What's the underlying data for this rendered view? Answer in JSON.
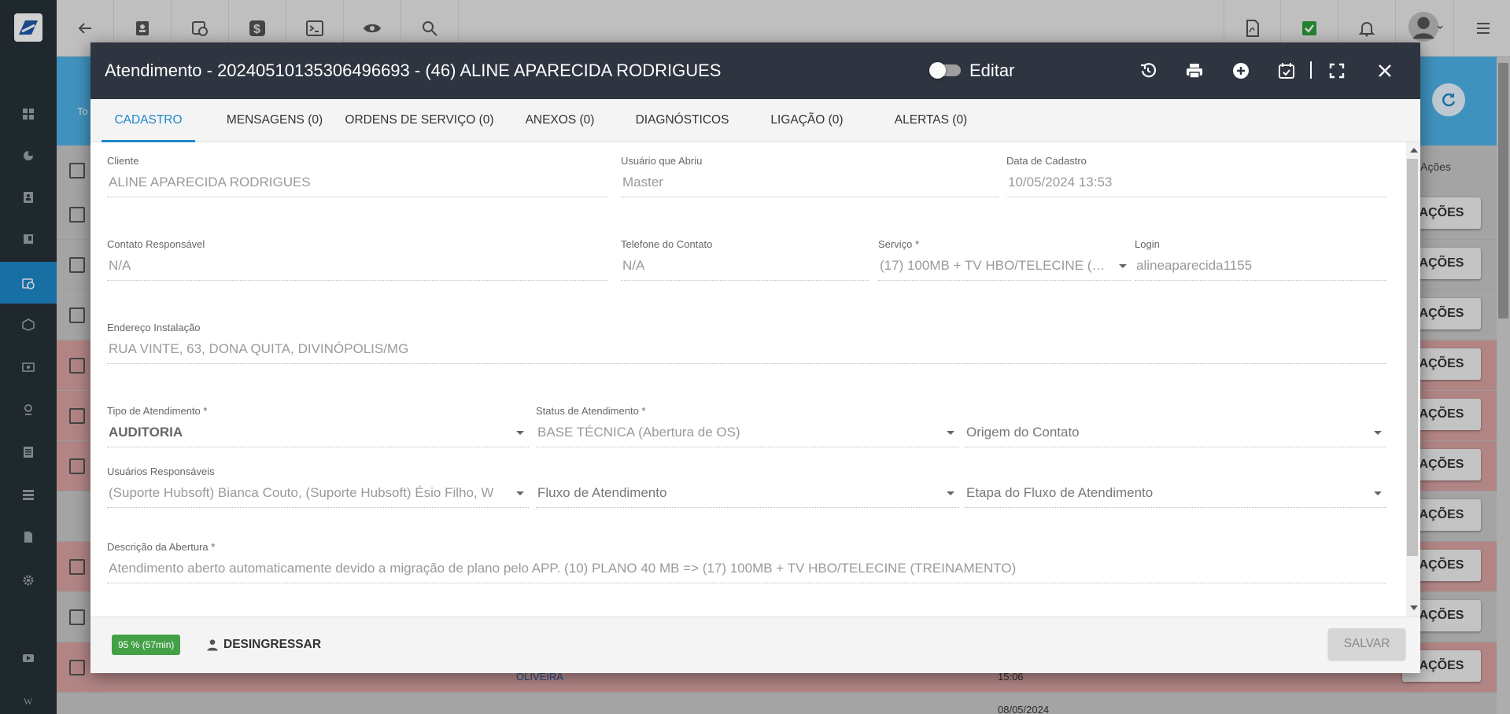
{
  "topbar": {
    "icons": [
      "back-arrow-icon",
      "contact-card-icon",
      "calendar-clock-icon",
      "dollar-icon",
      "terminal-icon",
      "eye-icon",
      "search-icon",
      "pdf-icon",
      "check-list-icon",
      "bell-icon",
      "avatar",
      "menu-icon"
    ]
  },
  "background": {
    "header_acoes": "Ações",
    "row_action": "AÇÕES",
    "partial_texts": {
      "banner": "To",
      "oliveira": "OLIVEIRA",
      "time": "15:06",
      "date": "08/05/2024"
    }
  },
  "modal": {
    "title": "Atendimento - 20240510135306496693 - (46) ALINE APARECIDA RODRIGUES",
    "edit_label": "Editar",
    "tabs": [
      {
        "label": "CADASTRO"
      },
      {
        "label": "MENSAGENS (0)"
      },
      {
        "label": "ORDENS DE SERVIÇO (0)"
      },
      {
        "label": "ANEXOS (0)"
      },
      {
        "label": "DIAGNÓSTICOS"
      },
      {
        "label": "LIGAÇÃO (0)"
      },
      {
        "label": "ALERTAS (0)"
      }
    ],
    "fields": {
      "cliente": {
        "label": "Cliente",
        "value": "ALINE APARECIDA RODRIGUES"
      },
      "usuario_abriu": {
        "label": "Usuário que Abriu",
        "value": "Master"
      },
      "data_cadastro": {
        "label": "Data de Cadastro",
        "value": "10/05/2024 13:53"
      },
      "contato_responsavel": {
        "label": "Contato Responsável",
        "value": "N/A"
      },
      "telefone_contato": {
        "label": "Telefone do Contato",
        "value": "N/A"
      },
      "servico": {
        "label": "Serviço *",
        "value": "(17) 100MB + TV HBO/TELECINE (…"
      },
      "login": {
        "label": "Login",
        "value": "alineaparecida1155"
      },
      "endereco": {
        "label": "Endereço Instalação",
        "value": "RUA VINTE, 63, DONA QUITA, DIVINÓPOLIS/MG"
      },
      "tipo_atendimento": {
        "label": "Tipo de Atendimento *",
        "value": "AUDITORIA"
      },
      "status_atendimento": {
        "label": "Status de Atendimento *",
        "value": "BASE TÉCNICA (Abertura de OS)"
      },
      "origem_contato": {
        "placeholder": "Origem do Contato"
      },
      "usuarios_responsaveis": {
        "label": "Usuários Responsáveis",
        "value": "(Suporte Hubsoft) Bianca Couto, (Suporte Hubsoft) Ésio Filho, W"
      },
      "fluxo_atendimento": {
        "placeholder": "Fluxo de Atendimento"
      },
      "etapa_fluxo": {
        "placeholder": "Etapa do Fluxo de Atendimento"
      },
      "descricao_abertura": {
        "label": "Descrição da Abertura *",
        "value": "Atendimento aberto automaticamente devido a migração de plano pelo APP. (10) PLANO 40 MB => (17) 100MB + TV HBO/TELECINE (TREINAMENTO)"
      }
    },
    "footer": {
      "sla_badge": "95 % (57min)",
      "desingressar_label": "DESINGRESSAR",
      "save_label": "SALVAR"
    }
  }
}
